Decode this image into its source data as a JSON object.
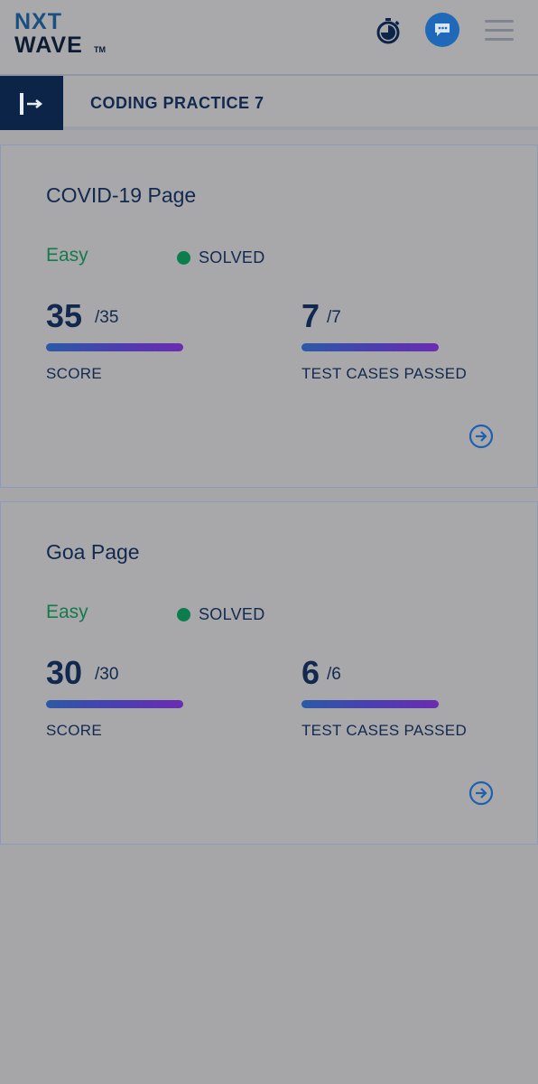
{
  "header": {
    "logo_line1": "NXT",
    "logo_line2": "WAVE",
    "logo_tm": "TM",
    "icons": [
      "stopwatch-icon",
      "chat-icon",
      "hamburger-menu-icon"
    ]
  },
  "subheader": {
    "title": "CODING PRACTICE 7",
    "toggle_icon": "sidebar-expand-icon"
  },
  "colors": {
    "background": "#a6a6a8",
    "navy": "#0c2448",
    "text": "#12294f",
    "easy_green": "#157a4c",
    "solved_dot": "#0c7d4d",
    "chat_blue": "#1f69b8"
  },
  "questions": [
    {
      "title": "COVID-19 Page",
      "difficulty": "Easy",
      "status": "SOLVED",
      "score": "35",
      "score_total": "/35",
      "score_label": "SCORE",
      "tests": "7",
      "tests_total": "/7",
      "tests_label": "TEST CASES PASSED"
    },
    {
      "title": "Goa Page",
      "difficulty": "Easy",
      "status": "SOLVED",
      "score": "30",
      "score_total": "/30",
      "score_label": "SCORE",
      "tests": "6",
      "tests_total": "/6",
      "tests_label": "TEST CASES PASSED"
    }
  ]
}
